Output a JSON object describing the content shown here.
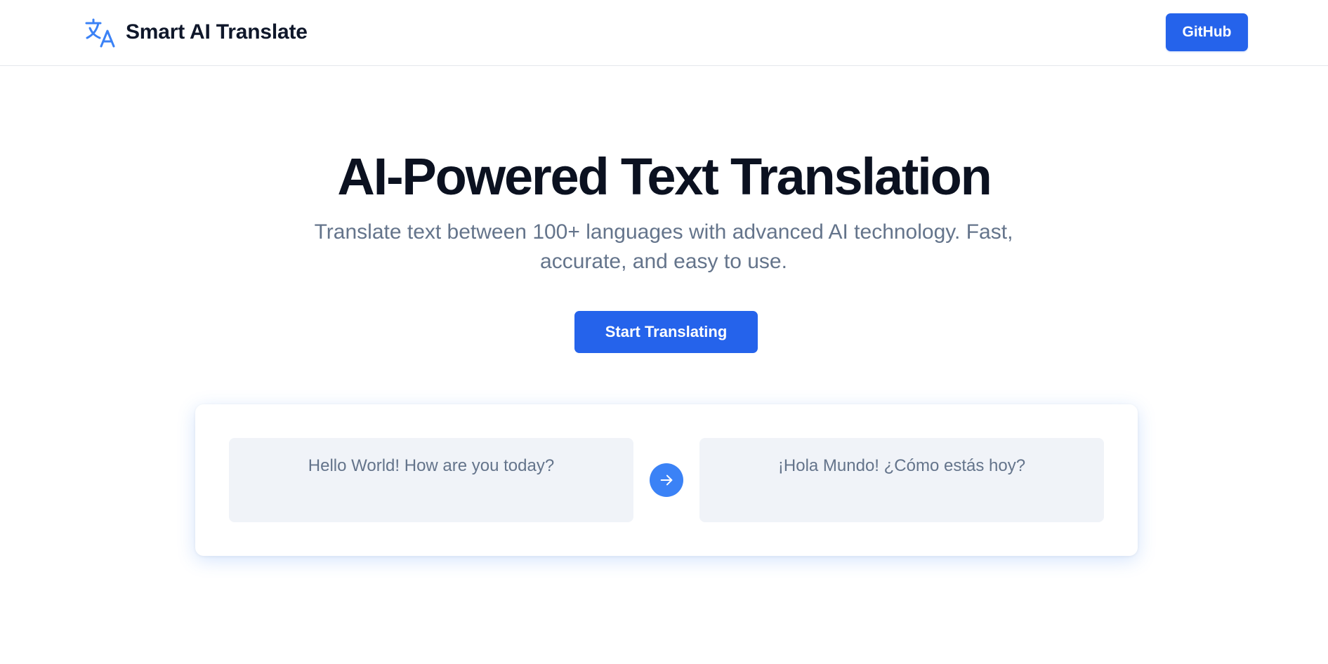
{
  "header": {
    "brand_name": "Smart AI Translate",
    "brand_icon": "translate-icon",
    "github_label": "GitHub"
  },
  "hero": {
    "title": "AI-Powered Text Translation",
    "subtitle": "Translate text between 100+ languages with advanced AI technology. Fast, accurate, and easy to use.",
    "cta_label": "Start Translating"
  },
  "demo": {
    "source_text": "Hello World! How are you today?",
    "target_text": "¡Hola Mundo! ¿Cómo estás hoy?",
    "arrow_icon": "arrow-right-icon"
  },
  "colors": {
    "accent": "#2563eb",
    "accent_light": "#3b82f6",
    "heading": "#0b1120",
    "muted_text": "#64748b",
    "box_bg": "#f0f3f8"
  }
}
